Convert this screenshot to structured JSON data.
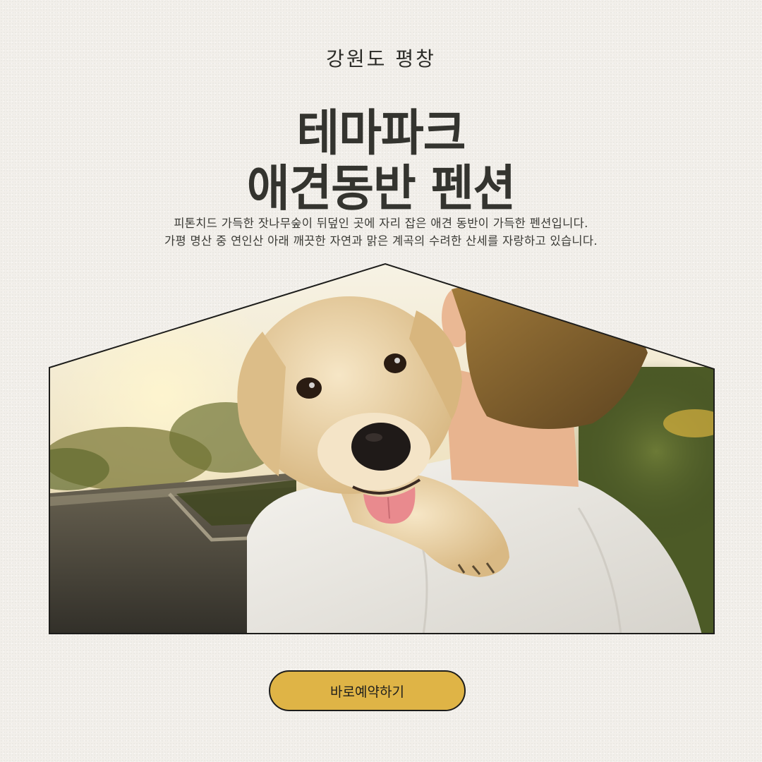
{
  "region_label": "강원도 평창",
  "title": {
    "line1": "테마파크",
    "line2": "애견동반 펜션"
  },
  "description": {
    "line1": "피톤치드 가득한 잣나무숲이 뒤덮인 곳에 자리 잡은 애견 동반이 가득한 펜션입니다.",
    "line2": "가평 명산 중 연인산 아래 깨끗한 자연과 맑은 계곡의 수려한 산세를 자랑하고 있습니다."
  },
  "photo": {
    "icon": "dog-hug-photo"
  },
  "cta": {
    "label": "바로예약하기"
  },
  "colors": {
    "background": "#f2efea",
    "button": "#dfb446",
    "text": "#34342f"
  }
}
